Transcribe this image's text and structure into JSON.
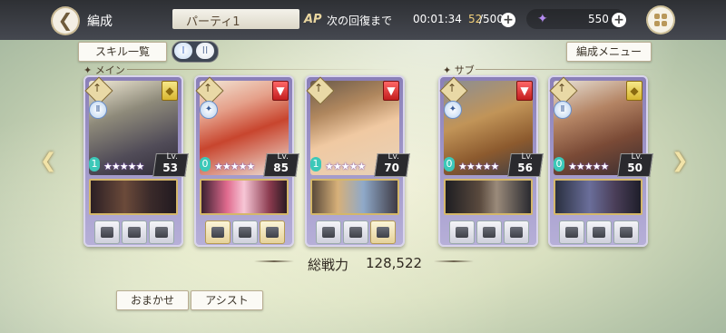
{
  "header": {
    "screen_title": "編成",
    "party_name": "パーティ1",
    "ap_label": "AP",
    "ap_recovery_label": "次の回復まで",
    "ap_time": "00:01:34",
    "ap_current": "52",
    "ap_max": "/500",
    "gem_count": "550"
  },
  "toolbar": {
    "skill_list_label": "スキル一覧",
    "formation_menu_label": "編成メニュー",
    "party_switch": [
      "I",
      "II"
    ]
  },
  "sections": {
    "main": "メイン",
    "sub": "サブ"
  },
  "cards": [
    {
      "level_label": "Lv.",
      "level": "53",
      "element": "gold",
      "stars": "★★★★★",
      "rank": "1"
    },
    {
      "level_label": "Lv.",
      "level": "85",
      "element": "red",
      "stars": "★★★★★",
      "rank": "0"
    },
    {
      "level_label": "Lv.",
      "level": "70",
      "element": "red",
      "stars": "★★★★★",
      "rank": "1"
    },
    {
      "level_label": "Lv.",
      "level": "56",
      "element": "red",
      "stars": "★★★★★",
      "rank": "0"
    },
    {
      "level_label": "Lv.",
      "level": "50",
      "element": "gold",
      "stars": "★★★★★",
      "rank": "0"
    }
  ],
  "total_power": {
    "label": "総戦力",
    "value": "128,522"
  },
  "footer": {
    "auto_label": "おまかせ",
    "assist_label": "アシスト"
  },
  "colors": {
    "topbar": "#2e3034",
    "card_frame": "#8a7fb8",
    "weapon_frame": "#d4b769"
  }
}
